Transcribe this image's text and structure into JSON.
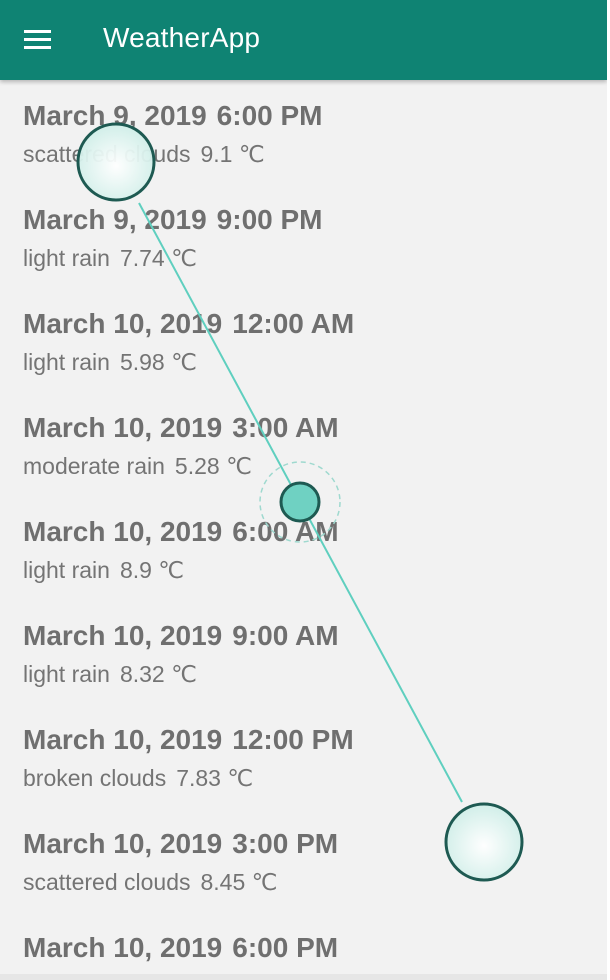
{
  "app_bar": {
    "title": "WeatherApp",
    "menu_icon": "hamburger-menu-icon",
    "background": "#0f8373"
  },
  "forecast": [
    {
      "date": "March 9, 2019",
      "time": "6:00 PM",
      "description": "scattered clouds",
      "temperature": "9.1 ℃"
    },
    {
      "date": "March 9, 2019",
      "time": "9:00 PM",
      "description": "light rain",
      "temperature": "7.74 ℃"
    },
    {
      "date": "March 10, 2019",
      "time": "12:00 AM",
      "description": "light rain",
      "temperature": "5.98 ℃"
    },
    {
      "date": "March 10, 2019",
      "time": "3:00 AM",
      "description": "moderate rain",
      "temperature": "5.28 ℃"
    },
    {
      "date": "March 10, 2019",
      "time": "6:00 AM",
      "description": "light rain",
      "temperature": "8.9 ℃"
    },
    {
      "date": "March 10, 2019",
      "time": "9:00 AM",
      "description": "light rain",
      "temperature": "8.32 ℃"
    },
    {
      "date": "March 10, 2019",
      "time": "12:00 PM",
      "description": "broken clouds",
      "temperature": "7.83 ℃"
    },
    {
      "date": "March 10, 2019",
      "time": "3:00 PM",
      "description": "scattered clouds",
      "temperature": "8.45 ℃"
    },
    {
      "date": "March 10, 2019",
      "time": "6:00 PM",
      "description": "",
      "temperature": ""
    }
  ],
  "gesture_overlay": {
    "color": "#5fcfbf",
    "fill": "#dff3ef",
    "stroke": "#1e5a52"
  }
}
